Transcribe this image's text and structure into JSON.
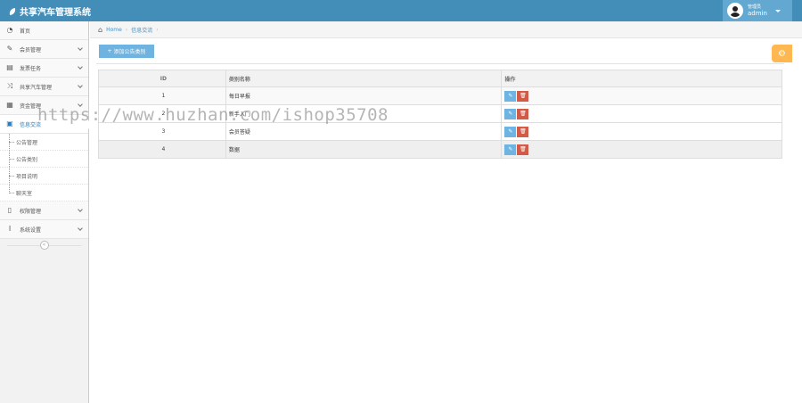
{
  "app": {
    "title": "共享汽车管理系统"
  },
  "user": {
    "role": "管理员",
    "name": "admin"
  },
  "sidebar": {
    "items": [
      {
        "label": "首页",
        "icon": "tachometer-icon"
      },
      {
        "label": "会员管理",
        "icon": "edit-icon"
      },
      {
        "label": "发票任务",
        "icon": "book-icon"
      },
      {
        "label": "共享汽车管理",
        "icon": "random-icon"
      },
      {
        "label": "资金管理",
        "icon": "calendar-icon"
      },
      {
        "label": "信息交流",
        "icon": "list-alt-icon"
      },
      {
        "label": "权限管理",
        "icon": "file-icon"
      },
      {
        "label": "系统设置",
        "icon": "text-width-icon"
      }
    ],
    "sub_items": [
      "公告管理",
      "公告类别",
      "项目说明",
      "聊天室"
    ],
    "collapse_symbol": "«"
  },
  "breadcrumb": {
    "home": "Home",
    "current": "信息交流"
  },
  "toolbar": {
    "add_label": "添加公告类别",
    "add_icon": "+",
    "settings_icon": "⚙"
  },
  "table": {
    "headers": [
      "ID",
      "类别名称",
      "操作"
    ],
    "rows": [
      {
        "id": "1",
        "name": "每日早报"
      },
      {
        "id": "2",
        "name": "新手入门"
      },
      {
        "id": "3",
        "name": "会员答疑"
      },
      {
        "id": "4",
        "name": "数据"
      }
    ]
  },
  "watermark": "https://www.huzhan.com/ishop35708"
}
